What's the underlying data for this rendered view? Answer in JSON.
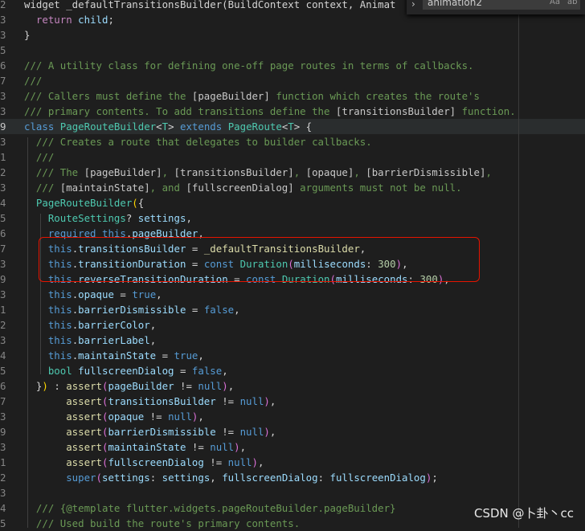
{
  "find_widget": {
    "query": "animation2",
    "match_case_label": "Aa",
    "whole_word_label": "ab"
  },
  "watermark": "CSDN @卜卦丶cc",
  "lines": [
    {
      "ln": "2",
      "tokens": [
        [
          "plain",
          "widget _defaultTransitionsBuilder(BuildContext context, Animat"
        ]
      ]
    },
    {
      "ln": "3",
      "tokens": [
        [
          "plain",
          "  "
        ],
        [
          "ctl",
          "return"
        ],
        [
          "plain",
          " "
        ],
        [
          "var",
          "child"
        ],
        [
          "plain",
          ";"
        ]
      ]
    },
    {
      "ln": "3",
      "tokens": [
        [
          "plain",
          "}"
        ]
      ]
    },
    {
      "ln": "5",
      "tokens": []
    },
    {
      "ln": "6",
      "tokens": [
        [
          "cmt",
          "/// A utility class for defining one-off page routes in terms of callbacks."
        ]
      ]
    },
    {
      "ln": "7",
      "tokens": [
        [
          "cmt",
          "///"
        ]
      ]
    },
    {
      "ln": "3",
      "tokens": [
        [
          "cmt",
          "/// Callers must define the "
        ],
        [
          "ref",
          "[pageBuilder]"
        ],
        [
          "cmt",
          " function which creates the route's"
        ]
      ]
    },
    {
      "ln": "3",
      "tokens": [
        [
          "cmt",
          "/// primary contents. To add transitions define the "
        ],
        [
          "ref",
          "[transitionsBuilder]"
        ],
        [
          "cmt",
          " function."
        ]
      ]
    },
    {
      "ln": "9",
      "active": true,
      "tokens": [
        [
          "kw",
          "class"
        ],
        [
          "plain",
          " "
        ],
        [
          "type",
          "PageRouteBuilder"
        ],
        [
          "plain",
          "<"
        ],
        [
          "type",
          "T"
        ],
        [
          "plain",
          "> "
        ],
        [
          "kw",
          "extends"
        ],
        [
          "plain",
          " "
        ],
        [
          "type",
          "PageRoute"
        ],
        [
          "plain",
          "<"
        ],
        [
          "type",
          "T"
        ],
        [
          "plain",
          "> {"
        ]
      ]
    },
    {
      "ln": "3",
      "tokens": [
        [
          "plain",
          "  "
        ],
        [
          "cmt",
          "/// Creates a route that delegates to builder callbacks."
        ]
      ]
    },
    {
      "ln": "1",
      "tokens": [
        [
          "plain",
          "  "
        ],
        [
          "cmt",
          "///"
        ]
      ]
    },
    {
      "ln": "2",
      "tokens": [
        [
          "plain",
          "  "
        ],
        [
          "cmt",
          "/// The "
        ],
        [
          "ref",
          "[pageBuilder]"
        ],
        [
          "cmt",
          ", "
        ],
        [
          "ref",
          "[transitionsBuilder]"
        ],
        [
          "cmt",
          ", "
        ],
        [
          "ref",
          "[opaque]"
        ],
        [
          "cmt",
          ", "
        ],
        [
          "ref",
          "[barrierDismissible]"
        ],
        [
          "cmt",
          ","
        ]
      ]
    },
    {
      "ln": "3",
      "tokens": [
        [
          "plain",
          "  "
        ],
        [
          "cmt",
          "/// "
        ],
        [
          "ref",
          "[maintainState]"
        ],
        [
          "cmt",
          ", and "
        ],
        [
          "ref",
          "[fullscreenDialog]"
        ],
        [
          "cmt",
          " arguments must not be null."
        ]
      ]
    },
    {
      "ln": "4",
      "tokens": [
        [
          "plain",
          "  "
        ],
        [
          "type",
          "PageRouteBuilder"
        ],
        [
          "par",
          "("
        ],
        [
          "plain",
          "{"
        ]
      ]
    },
    {
      "ln": "5",
      "tokens": [
        [
          "plain",
          "    "
        ],
        [
          "type",
          "RouteSettings"
        ],
        [
          "plain",
          "? "
        ],
        [
          "var",
          "settings"
        ],
        [
          "plain",
          ","
        ]
      ]
    },
    {
      "ln": "6",
      "tokens": [
        [
          "plain",
          "    "
        ],
        [
          "kw",
          "required"
        ],
        [
          "plain",
          " "
        ],
        [
          "kw",
          "this"
        ],
        [
          "plain",
          "."
        ],
        [
          "var",
          "pageBuilder"
        ],
        [
          "plain",
          ","
        ]
      ]
    },
    {
      "ln": "7",
      "tokens": [
        [
          "plain",
          "    "
        ],
        [
          "kw",
          "this"
        ],
        [
          "plain",
          "."
        ],
        [
          "var",
          "transitionsBuilder"
        ],
        [
          "plain",
          " = "
        ],
        [
          "fn",
          "_defaultTransitionsBuilder"
        ],
        [
          "plain",
          ","
        ]
      ]
    },
    {
      "ln": "3",
      "tokens": [
        [
          "plain",
          "    "
        ],
        [
          "kw",
          "this"
        ],
        [
          "plain",
          "."
        ],
        [
          "var",
          "transitionDuration"
        ],
        [
          "plain",
          " = "
        ],
        [
          "kw",
          "const"
        ],
        [
          "plain",
          " "
        ],
        [
          "type",
          "Duration"
        ],
        [
          "par2",
          "("
        ],
        [
          "var",
          "milliseconds"
        ],
        [
          "plain",
          ": "
        ],
        [
          "num",
          "300"
        ],
        [
          "par2",
          ")"
        ],
        [
          "plain",
          ","
        ]
      ]
    },
    {
      "ln": "9",
      "tokens": [
        [
          "plain",
          "    "
        ],
        [
          "kw",
          "this"
        ],
        [
          "plain",
          "."
        ],
        [
          "var",
          "reverseTransitionDuration"
        ],
        [
          "plain",
          " = "
        ],
        [
          "kw",
          "const"
        ],
        [
          "plain",
          " "
        ],
        [
          "type",
          "Duration"
        ],
        [
          "par2",
          "("
        ],
        [
          "var",
          "milliseconds"
        ],
        [
          "plain",
          ": "
        ],
        [
          "num",
          "300"
        ],
        [
          "par2",
          ")"
        ],
        [
          "plain",
          ","
        ]
      ]
    },
    {
      "ln": "3",
      "tokens": [
        [
          "plain",
          "    "
        ],
        [
          "kw",
          "this"
        ],
        [
          "plain",
          "."
        ],
        [
          "var",
          "opaque"
        ],
        [
          "plain",
          " = "
        ],
        [
          "kw",
          "true"
        ],
        [
          "plain",
          ","
        ]
      ]
    },
    {
      "ln": "1",
      "tokens": [
        [
          "plain",
          "    "
        ],
        [
          "kw",
          "this"
        ],
        [
          "plain",
          "."
        ],
        [
          "var",
          "barrierDismissible"
        ],
        [
          "plain",
          " = "
        ],
        [
          "kw",
          "false"
        ],
        [
          "plain",
          ","
        ]
      ]
    },
    {
      "ln": "2",
      "tokens": [
        [
          "plain",
          "    "
        ],
        [
          "kw",
          "this"
        ],
        [
          "plain",
          "."
        ],
        [
          "var",
          "barrierColor"
        ],
        [
          "plain",
          ","
        ]
      ]
    },
    {
      "ln": "3",
      "tokens": [
        [
          "plain",
          "    "
        ],
        [
          "kw",
          "this"
        ],
        [
          "plain",
          "."
        ],
        [
          "var",
          "barrierLabel"
        ],
        [
          "plain",
          ","
        ]
      ]
    },
    {
      "ln": "4",
      "tokens": [
        [
          "plain",
          "    "
        ],
        [
          "kw",
          "this"
        ],
        [
          "plain",
          "."
        ],
        [
          "var",
          "maintainState"
        ],
        [
          "plain",
          " = "
        ],
        [
          "kw",
          "true"
        ],
        [
          "plain",
          ","
        ]
      ]
    },
    {
      "ln": "5",
      "tokens": [
        [
          "plain",
          "    "
        ],
        [
          "type",
          "bool"
        ],
        [
          "plain",
          " "
        ],
        [
          "var",
          "fullscreenDialog"
        ],
        [
          "plain",
          " = "
        ],
        [
          "kw",
          "false"
        ],
        [
          "plain",
          ","
        ]
      ]
    },
    {
      "ln": "6",
      "tokens": [
        [
          "plain",
          "  }"
        ],
        [
          "par",
          ")"
        ],
        [
          "plain",
          " : "
        ],
        [
          "fn",
          "assert"
        ],
        [
          "par2",
          "("
        ],
        [
          "var",
          "pageBuilder"
        ],
        [
          "plain",
          " != "
        ],
        [
          "kw",
          "null"
        ],
        [
          "par2",
          ")"
        ],
        [
          "plain",
          ","
        ]
      ]
    },
    {
      "ln": "7",
      "tokens": [
        [
          "plain",
          "       "
        ],
        [
          "fn",
          "assert"
        ],
        [
          "par2",
          "("
        ],
        [
          "var",
          "transitionsBuilder"
        ],
        [
          "plain",
          " != "
        ],
        [
          "kw",
          "null"
        ],
        [
          "par2",
          ")"
        ],
        [
          "plain",
          ","
        ]
      ]
    },
    {
      "ln": "3",
      "tokens": [
        [
          "plain",
          "       "
        ],
        [
          "fn",
          "assert"
        ],
        [
          "par2",
          "("
        ],
        [
          "var",
          "opaque"
        ],
        [
          "plain",
          " != "
        ],
        [
          "kw",
          "null"
        ],
        [
          "par2",
          ")"
        ],
        [
          "plain",
          ","
        ]
      ]
    },
    {
      "ln": "9",
      "tokens": [
        [
          "plain",
          "       "
        ],
        [
          "fn",
          "assert"
        ],
        [
          "par2",
          "("
        ],
        [
          "var",
          "barrierDismissible"
        ],
        [
          "plain",
          " != "
        ],
        [
          "kw",
          "null"
        ],
        [
          "par2",
          ")"
        ],
        [
          "plain",
          ","
        ]
      ]
    },
    {
      "ln": "3",
      "tokens": [
        [
          "plain",
          "       "
        ],
        [
          "fn",
          "assert"
        ],
        [
          "par2",
          "("
        ],
        [
          "var",
          "maintainState"
        ],
        [
          "plain",
          " != "
        ],
        [
          "kw",
          "null"
        ],
        [
          "par2",
          ")"
        ],
        [
          "plain",
          ","
        ]
      ]
    },
    {
      "ln": "1",
      "tokens": [
        [
          "plain",
          "       "
        ],
        [
          "fn",
          "assert"
        ],
        [
          "par2",
          "("
        ],
        [
          "var",
          "fullscreenDialog"
        ],
        [
          "plain",
          " != "
        ],
        [
          "kw",
          "null"
        ],
        [
          "par2",
          ")"
        ],
        [
          "plain",
          ","
        ]
      ]
    },
    {
      "ln": "2",
      "tokens": [
        [
          "plain",
          "       "
        ],
        [
          "kw",
          "super"
        ],
        [
          "par2",
          "("
        ],
        [
          "var",
          "settings"
        ],
        [
          "plain",
          ": "
        ],
        [
          "var",
          "settings"
        ],
        [
          "plain",
          ", "
        ],
        [
          "var",
          "fullscreenDialog"
        ],
        [
          "plain",
          ": "
        ],
        [
          "var",
          "fullscreenDialog"
        ],
        [
          "par2",
          ")"
        ],
        [
          "plain",
          ";"
        ]
      ]
    },
    {
      "ln": "3",
      "tokens": []
    },
    {
      "ln": "4",
      "tokens": [
        [
          "plain",
          "  "
        ],
        [
          "cmt",
          "/// {@template flutter.widgets.pageRouteBuilder.pageBuilder}"
        ]
      ]
    },
    {
      "ln": "5",
      "tokens": [
        [
          "plain",
          "  "
        ],
        [
          "cmt",
          "/// Used build the route's primary contents."
        ]
      ]
    }
  ]
}
